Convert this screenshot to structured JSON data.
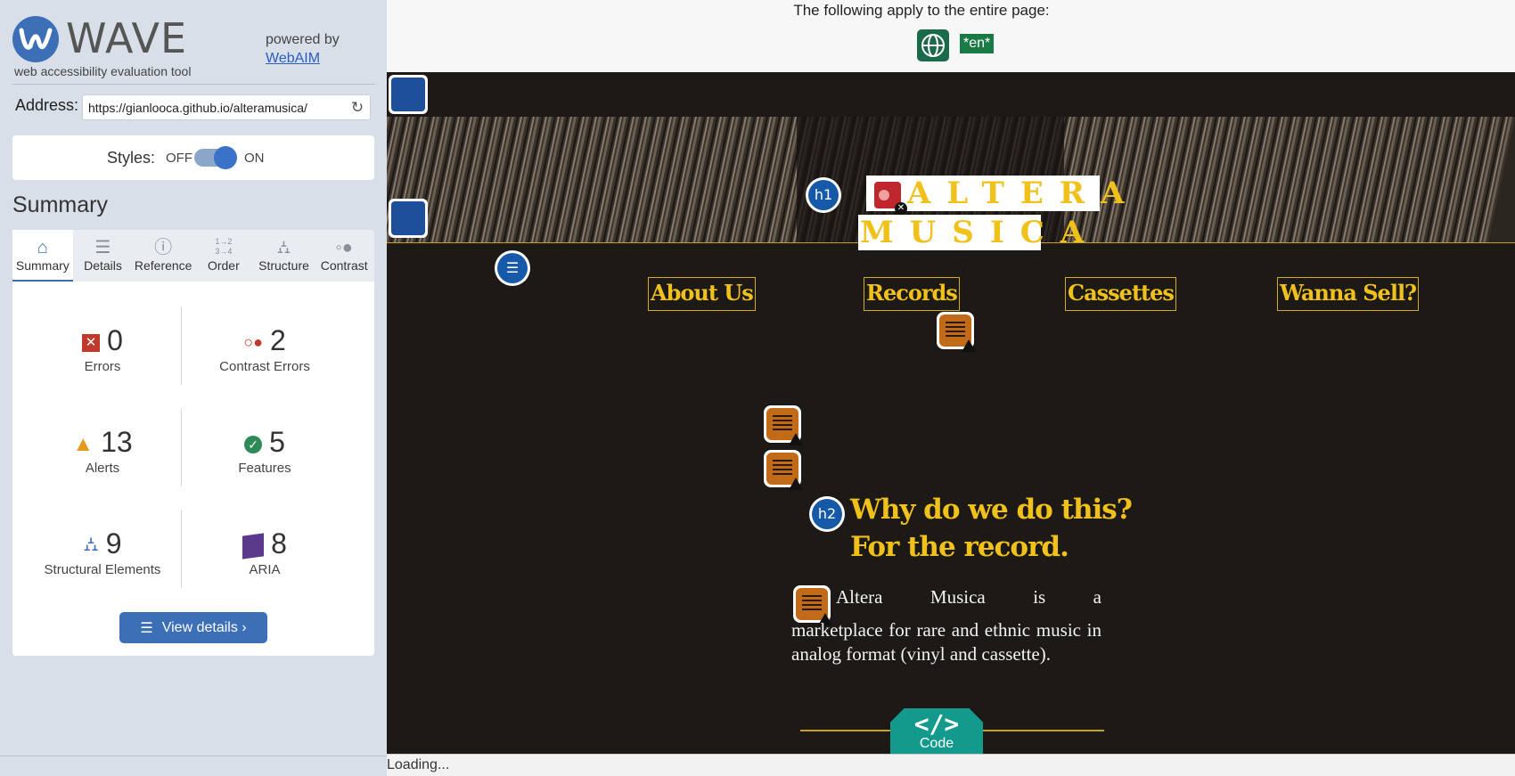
{
  "brand": {
    "name": "WAVE",
    "tagline": "web accessibility evaluation tool",
    "powered_by": "powered by",
    "webaim": "WebAIM"
  },
  "address": {
    "label": "Address:",
    "value": "https://gianlooca.github.io/alteramusica/"
  },
  "styles": {
    "label": "Styles:",
    "off": "OFF",
    "on": "ON",
    "enabled": true
  },
  "summary_title": "Summary",
  "tabs": [
    {
      "label": "Summary",
      "icon": "home-icon",
      "active": true
    },
    {
      "label": "Details",
      "icon": "list-icon"
    },
    {
      "label": "Reference",
      "icon": "info-icon"
    },
    {
      "label": "Order",
      "icon": "order-icon",
      "glyph": "1→2 3→4"
    },
    {
      "label": "Structure",
      "icon": "hierarchy-icon"
    },
    {
      "label": "Contrast",
      "icon": "contrast-icon"
    }
  ],
  "stats": {
    "errors": {
      "count": "0",
      "label": "Errors",
      "color": "#c0392b"
    },
    "contrast": {
      "count": "2",
      "label": "Contrast Errors",
      "color": "#c0392b"
    },
    "alerts": {
      "count": "13",
      "label": "Alerts",
      "color": "#e69a1c"
    },
    "features": {
      "count": "5",
      "label": "Features",
      "color": "#2e8b57"
    },
    "structural": {
      "count": "9",
      "label": "Structural Elements",
      "color": "#3d6fb7"
    },
    "aria": {
      "count": "8",
      "label": "ARIA",
      "color": "#5b3a8c"
    }
  },
  "view_details": "View details ›",
  "page_notice": "The following apply to the entire page:",
  "lang_badge": "*en*",
  "site": {
    "logo_line1": "ALTERA",
    "logo_line2": "MUSICA",
    "nav": [
      "About Us",
      "Records",
      "Cassettes",
      "Wanna Sell?"
    ],
    "heading_line1": "Why do we do this?",
    "heading_line2": "For the record.",
    "para_first": "Altera Musica is a",
    "para_rest": "marketplace for rare and ethnic music in analog format (vinyl and cassette)."
  },
  "wave_icons": {
    "h1": "h1",
    "h2": "h2"
  },
  "code_button": {
    "glyph": "</>",
    "label": "Code"
  },
  "status": "Loading..."
}
